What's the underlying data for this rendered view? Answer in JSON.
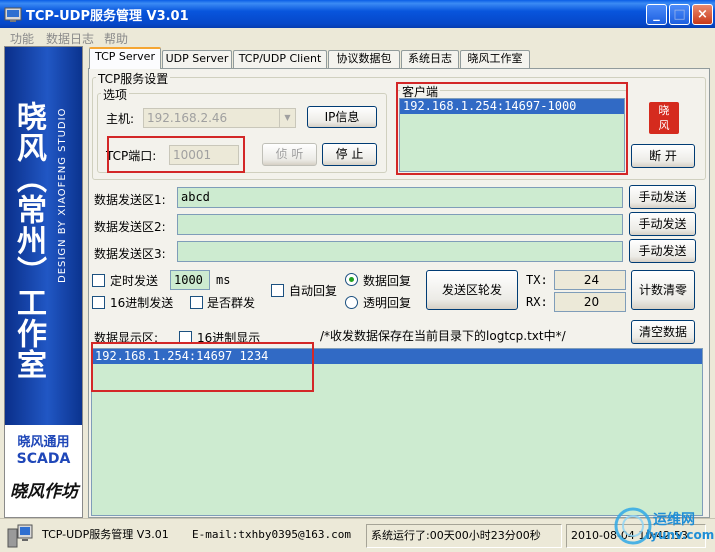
{
  "window": {
    "title": "TCP-UDP服务管理 V3.01",
    "minimize": "_",
    "maximize": "□",
    "close": "×"
  },
  "menu": [
    "功能",
    "数据日志",
    "帮助"
  ],
  "banner": {
    "main": "晓风（常州）工作室",
    "sub": "DESIGN BY XIAOFENG STUDIO",
    "scada1": "晓风通用",
    "scada2": "SCADA",
    "signature": "晓风作坊"
  },
  "tabs": [
    "TCP Server",
    "UDP Server",
    "TCP/UDP Client",
    "协议数据包",
    "系统日志",
    "晓风工作室"
  ],
  "server_settings": {
    "group_label": "TCP服务设置",
    "options_label": "选项",
    "host_label": "主机:",
    "host_value": "192.168.2.46",
    "ip_info_button": "IP信息",
    "port_label": "TCP端口:",
    "port_value": "10001",
    "listen_button": "侦 听",
    "stop_button": "停 止"
  },
  "client": {
    "label": "客户端",
    "items": [
      "192.168.1.254:14697-1000"
    ],
    "disconnect_button": "断 开",
    "seal_text": "晓风"
  },
  "send": {
    "rows": [
      {
        "label": "数据发送区1:",
        "value": "abcd",
        "button": "手动发送"
      },
      {
        "label": "数据发送区2:",
        "value": "",
        "button": "手动发送"
      },
      {
        "label": "数据发送区3:",
        "value": "",
        "button": "手动发送"
      }
    ]
  },
  "controls": {
    "timed_send_label": "定时发送",
    "interval_value": "1000",
    "interval_unit": "ms",
    "hex_send_label": "16进制发送",
    "broadcast_label": "是否群发",
    "auto_reply_label": "自动回复",
    "data_reply_label": "数据回复",
    "transparent_reply_label": "透明回复",
    "rotate_button": "发送区轮发",
    "tx_label": "TX:",
    "tx_value": "24",
    "rx_label": "RX:",
    "rx_value": "20",
    "clear_count_button": "计数清零"
  },
  "display": {
    "label": "数据显示区:",
    "hex_display_label": "16进制显示",
    "note": "/*收发数据保存在当前目录下的logtcp.txt中*/",
    "clear_button": "清空数据",
    "lines": [
      "192.168.1.254:14697 1234"
    ]
  },
  "status": {
    "app": "TCP-UDP服务管理 V3.01",
    "email": "E-mail:txhby0395@163.com",
    "runtime": "系统运行了:00天00小时23分00秒",
    "datetime": "2010-08-04 10:42:53"
  },
  "watermark": {
    "text": "运维网",
    "url": "iyunv.com"
  }
}
